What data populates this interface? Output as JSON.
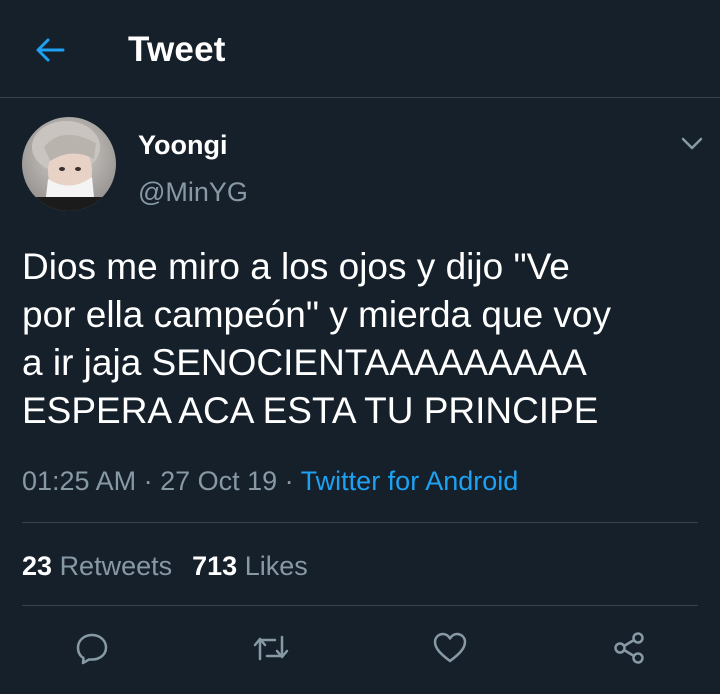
{
  "header": {
    "title": "Tweet",
    "back_icon": "arrow-left-icon"
  },
  "author": {
    "display_name": "Yoongi",
    "handle": "@MinYG",
    "menu_icon": "chevron-down-icon"
  },
  "tweet": {
    "text": "Dios me miro a los ojos y dijo \"Ve\npor ella campeón\" y mierda que voy\na ir jaja SENOCIENTAAAAAAAAA\nESPERA ACA ESTA TU PRINCIPE",
    "time": "01:25 AM",
    "separator": " · ",
    "date": "27 Oct 19",
    "source": "Twitter for Android"
  },
  "stats": {
    "retweets_count": "23",
    "retweets_label": "Retweets",
    "likes_count": "713",
    "likes_label": "Likes"
  },
  "actions": [
    "reply-icon",
    "retweet-icon",
    "like-icon",
    "share-icon"
  ],
  "colors": {
    "background": "#15202b",
    "accent": "#1da1f2",
    "secondary_text": "#8899a6",
    "divider": "#38444d"
  }
}
